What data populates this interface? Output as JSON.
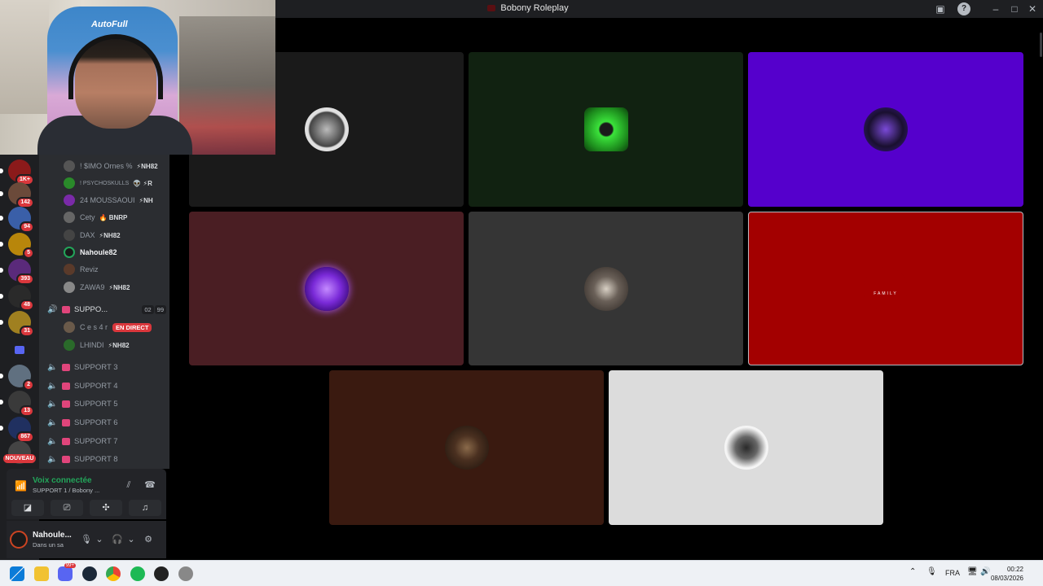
{
  "window": {
    "title": "Bobony Roleplay"
  },
  "servers": [
    {
      "badge": "1K+"
    },
    {
      "badge": "142"
    },
    {
      "badge": "94"
    },
    {
      "badge": "5"
    },
    {
      "badge": "393"
    },
    {
      "badge": "48"
    },
    {
      "badge": "31"
    },
    {
      "badge": "2"
    },
    {
      "badge": "13"
    },
    {
      "badge": "867"
    }
  ],
  "servers_new_label": "NOUVEAU",
  "members": [
    {
      "name": "! $IMO Ornes %",
      "tag": "⚡NH82"
    },
    {
      "name": "! PSYCHOSKULLS",
      "tag": "👽 ⚡R"
    },
    {
      "name": "24 MOUSSAOUI",
      "tag": "⚡NH"
    },
    {
      "name": "Cety",
      "tag": "🔥 BNRP"
    },
    {
      "name": "DAX",
      "tag": "⚡NH82"
    },
    {
      "name": "Nahoule82",
      "tag": ""
    },
    {
      "name": "Reviz",
      "tag": ""
    },
    {
      "name": "ZAWA9",
      "tag": "⚡NH82"
    }
  ],
  "active_channel": {
    "name": "SUPPO...",
    "count_a": "02",
    "count_b": "99"
  },
  "active_members": [
    {
      "name": "C e s 4 r",
      "live": "EN DIRECT"
    },
    {
      "name": "LHINDI",
      "tag": "⚡NH82"
    }
  ],
  "channels": [
    "SUPPORT 3",
    "SUPPORT 4",
    "SUPPORT 5",
    "SUPPORT 6",
    "SUPPORT 7",
    "SUPPORT 8"
  ],
  "voice": {
    "status": "Voix connectée",
    "location": "SUPPORT 1 / Bobony ..."
  },
  "user": {
    "name": "Nahoule...",
    "status": "Dans un sa"
  },
  "tiles": [
    {
      "bg": "#1a1a1a"
    },
    {
      "bg": "#112211"
    },
    {
      "bg": "#5500cc"
    },
    {
      "bg": "#4a1e23"
    },
    {
      "bg": "#353535"
    },
    {
      "bg": "#a30000",
      "caption": "FAMILY"
    },
    {
      "bg": "#3a1a10"
    },
    {
      "bg": "#dcdcdc"
    }
  ],
  "taskbar": {
    "discord_badge": "99+",
    "lang": "FRA",
    "time": "00:22",
    "date": "08/03/2026"
  },
  "colors": {
    "accent": "#5865f2",
    "voice_green": "#23a55a",
    "live_red": "#da373c"
  }
}
